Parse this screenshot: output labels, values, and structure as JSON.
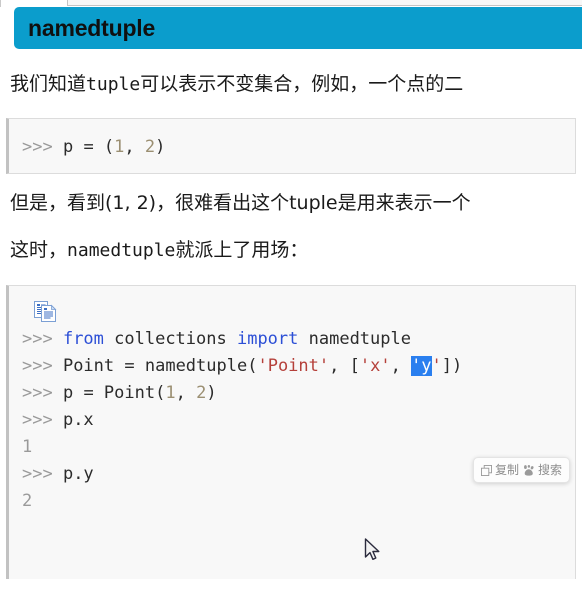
{
  "heading": {
    "title": "namedtuple"
  },
  "paragraphs": {
    "p1_a": "我们知道",
    "p1_mono": "tuple",
    "p1_b": "可以表示不变集合，例如，一个点的二",
    "p2": "但是，看到(1, 2)，很难看出这个tuple是用来表示一个",
    "p3_a": "这时，",
    "p3_mono": "namedtuple",
    "p3_b": "就派上了用场："
  },
  "code_block_1": {
    "lines": [
      {
        "tokens": [
          {
            "text": ">>> ",
            "type": "prompt"
          },
          {
            "text": "p ",
            "type": "plain"
          },
          {
            "text": "= ",
            "type": "op"
          },
          {
            "text": "(",
            "type": "punct"
          },
          {
            "text": "1",
            "type": "num"
          },
          {
            "text": ", ",
            "type": "punct"
          },
          {
            "text": "2",
            "type": "num"
          },
          {
            "text": ")",
            "type": "punct"
          }
        ]
      }
    ]
  },
  "code_block_2": {
    "copy_icon": "copy-document-icon",
    "lines": [
      {
        "tokens": [
          {
            "text": ">>> ",
            "type": "prompt"
          },
          {
            "text": "from",
            "type": "kw"
          },
          {
            "text": " collections ",
            "type": "plain"
          },
          {
            "text": "import",
            "type": "kw"
          },
          {
            "text": " namedtuple",
            "type": "plain"
          }
        ]
      },
      {
        "tokens": [
          {
            "text": ">>> ",
            "type": "prompt"
          },
          {
            "text": "Point ",
            "type": "plain"
          },
          {
            "text": "= ",
            "type": "op"
          },
          {
            "text": "namedtuple",
            "type": "plain"
          },
          {
            "text": "(",
            "type": "punct"
          },
          {
            "text": "'Point'",
            "type": "str"
          },
          {
            "text": ", ",
            "type": "punct"
          },
          {
            "text": "[",
            "type": "punct"
          },
          {
            "text": "'x'",
            "type": "str"
          },
          {
            "text": ", ",
            "type": "punct"
          },
          {
            "text": "'y",
            "type": "selected"
          },
          {
            "text": "'",
            "type": "str"
          },
          {
            "text": "])",
            "type": "punct"
          }
        ]
      },
      {
        "tokens": [
          {
            "text": ">>> ",
            "type": "prompt"
          },
          {
            "text": "p ",
            "type": "plain"
          },
          {
            "text": "= ",
            "type": "op"
          },
          {
            "text": "Point",
            "type": "plain"
          },
          {
            "text": "(",
            "type": "punct"
          },
          {
            "text": "1",
            "type": "num"
          },
          {
            "text": ", ",
            "type": "punct"
          },
          {
            "text": "2",
            "type": "num"
          },
          {
            "text": ")",
            "type": "punct"
          }
        ]
      },
      {
        "tokens": [
          {
            "text": ">>> ",
            "type": "prompt"
          },
          {
            "text": "p.x",
            "type": "plain"
          }
        ]
      },
      {
        "tokens": [
          {
            "text": "1",
            "type": "out"
          }
        ]
      },
      {
        "tokens": [
          {
            "text": ">>> ",
            "type": "prompt"
          },
          {
            "text": "p.y",
            "type": "plain"
          }
        ]
      },
      {
        "tokens": [
          {
            "text": "2",
            "type": "out"
          }
        ]
      }
    ]
  },
  "context_popup": {
    "items": [
      {
        "icon": "copy-icon",
        "label": "复制"
      },
      {
        "icon": "baidu-paw-search-icon",
        "label": "搜索"
      }
    ]
  },
  "colors": {
    "heading_banner": "#0b9dcc",
    "selection": "#2a7fef",
    "keyword": "#2c4fd6",
    "string": "#b5403a",
    "prompt": "#9a9a9a",
    "code_background": "#f8f8f8"
  }
}
